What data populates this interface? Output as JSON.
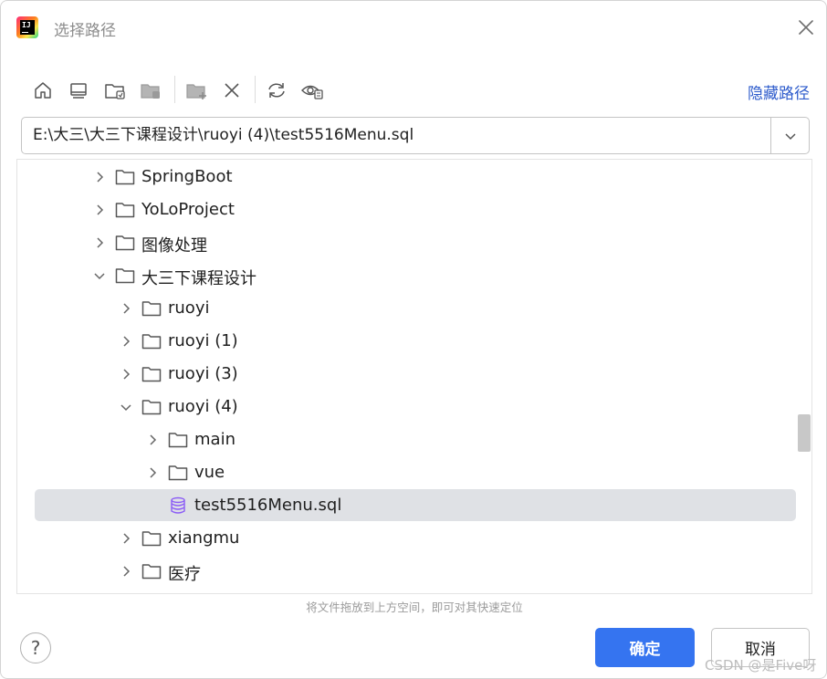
{
  "window": {
    "title": "选择路径",
    "app_icon_text": "IJ"
  },
  "toolbar": {
    "buttons": [
      "home-icon",
      "desktop-icon",
      "project-folder-icon",
      "module-folder-icon",
      "new-folder-icon",
      "delete-icon",
      "refresh-icon",
      "show-hidden-icon"
    ],
    "hide_path_label": "隐藏路径"
  },
  "path": {
    "value": "E:\\大三\\大三下课程设计\\ruoyi (4)\\test5516Menu.sql"
  },
  "tree": {
    "rows": [
      {
        "label": "SpringBoot",
        "type": "folder",
        "level": 2,
        "expanded": false
      },
      {
        "label": "YoLoProject",
        "type": "folder",
        "level": 2,
        "expanded": false
      },
      {
        "label": "图像处理",
        "type": "folder",
        "level": 2,
        "expanded": false
      },
      {
        "label": "大三下课程设计",
        "type": "folder",
        "level": 2,
        "expanded": true
      },
      {
        "label": "ruoyi",
        "type": "folder",
        "level": 3,
        "expanded": false
      },
      {
        "label": "ruoyi (1)",
        "type": "folder",
        "level": 3,
        "expanded": false
      },
      {
        "label": "ruoyi (3)",
        "type": "folder",
        "level": 3,
        "expanded": false
      },
      {
        "label": "ruoyi (4)",
        "type": "folder",
        "level": 3,
        "expanded": true
      },
      {
        "label": "main",
        "type": "folder",
        "level": 4,
        "expanded": false
      },
      {
        "label": "vue",
        "type": "folder",
        "level": 4,
        "expanded": false
      },
      {
        "label": "test5516Menu.sql",
        "type": "file",
        "level": 4,
        "selected": true
      },
      {
        "label": "xiangmu",
        "type": "folder",
        "level": 3,
        "expanded": false
      },
      {
        "label": "医疗",
        "type": "folder",
        "level": 3,
        "expanded": false
      }
    ]
  },
  "hint": "将文件拖放到上方空间，即可对其快速定位",
  "buttons": {
    "help": "?",
    "ok": "确定",
    "cancel": "取消"
  },
  "watermark": "CSDN @是Five呀",
  "colors": {
    "accent": "#3574f0",
    "link": "#2e5ccc",
    "selection": "#dfe1e5",
    "sql_icon": "#8b5cf6"
  }
}
